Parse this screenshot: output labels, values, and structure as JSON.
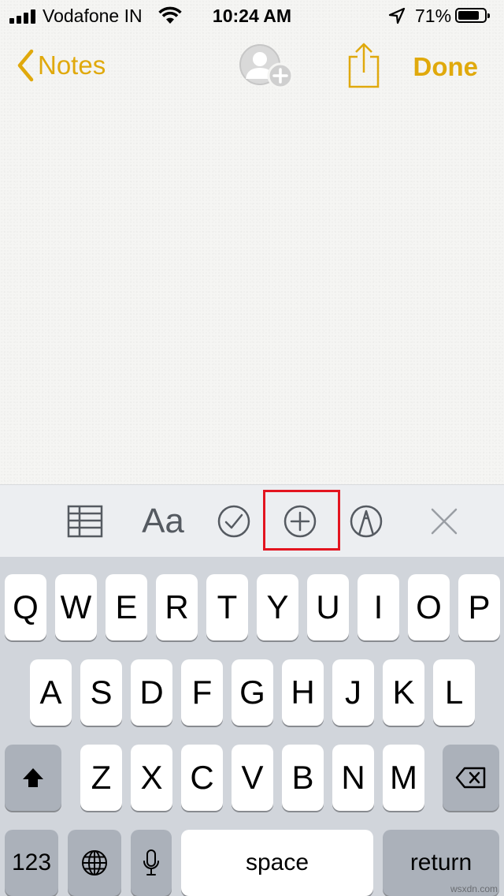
{
  "status_bar": {
    "carrier": "Vodafone IN",
    "time": "10:24 AM",
    "battery_percent": "71%",
    "battery_level": 0.71
  },
  "nav": {
    "back_label": "Notes",
    "done_label": "Done"
  },
  "toolbar": {
    "format_label": "Aa",
    "accent_color": "#e0a90c",
    "highlight_color": "#e3141f"
  },
  "keyboard": {
    "row1": [
      "Q",
      "W",
      "E",
      "R",
      "T",
      "Y",
      "U",
      "I",
      "O",
      "P"
    ],
    "row2": [
      "A",
      "S",
      "D",
      "F",
      "G",
      "H",
      "J",
      "K",
      "L"
    ],
    "row3": [
      "Z",
      "X",
      "C",
      "V",
      "B",
      "N",
      "M"
    ],
    "numbers_label": "123",
    "space_label": "space",
    "return_label": "return"
  },
  "watermark": "wsxdn.com"
}
